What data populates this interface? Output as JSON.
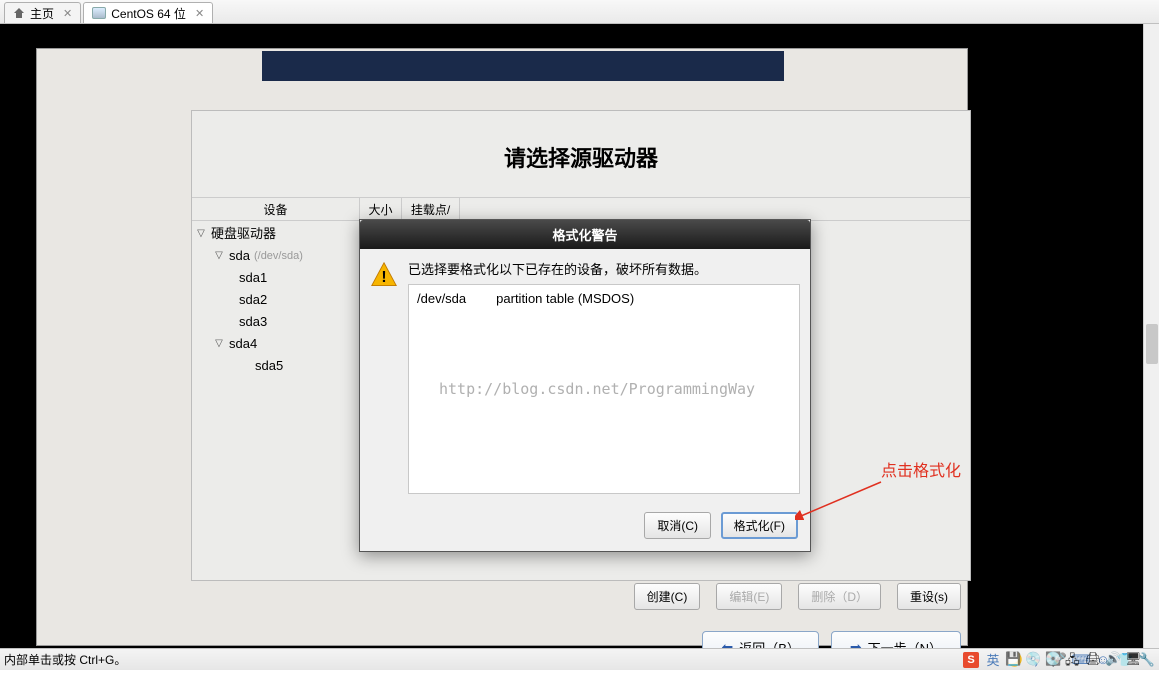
{
  "tabs": {
    "home": "主页",
    "vm": "CentOS 64 位"
  },
  "installer": {
    "title": "请选择源驱动器",
    "columns": {
      "device": "设备",
      "size": "大小",
      "mount": "挂载点/"
    },
    "tree": {
      "root": "硬盘驱动器",
      "sda": "sda",
      "sda_path": "(/dev/sda)",
      "sda1": "sda1",
      "sda2": "sda2",
      "sda3": "sda3",
      "sda4": "sda4",
      "sda5": "sda5"
    },
    "actions": {
      "create": "创建(C)",
      "edit": "编辑(E)",
      "delete": "删除（D）",
      "reset": "重设(s)"
    },
    "nav": {
      "back": "返回（B）",
      "next": "下一步（N）"
    }
  },
  "modal": {
    "title": "格式化警告",
    "message": "已选择要格式化以下已存在的设备，破坏所有数据。",
    "device": "/dev/sda",
    "detail": "partition table (MSDOS)",
    "watermark": "http://blog.csdn.net/ProgrammingWay",
    "cancel": "取消(C)",
    "format": "格式化(F)"
  },
  "annotation": "点击格式化",
  "status": {
    "hint": "内部单击或按 Ctrl+G。",
    "ime": "英"
  }
}
